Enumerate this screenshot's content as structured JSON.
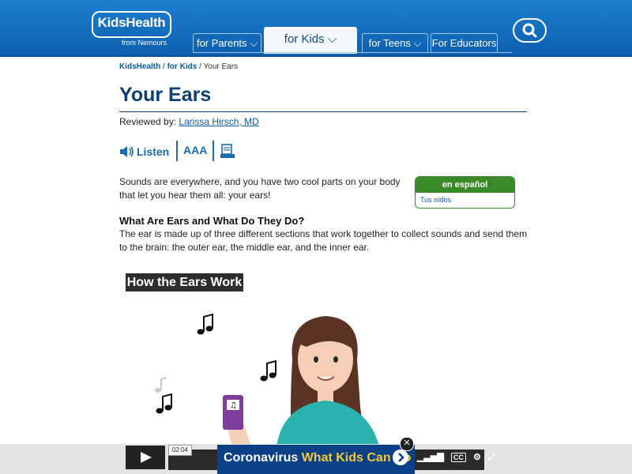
{
  "header": {
    "logo_text": "KidsHealth",
    "logo_sub": "from Nemours",
    "tabs": [
      {
        "label": "for Parents",
        "active": false
      },
      {
        "label": "for Kids",
        "active": true
      },
      {
        "label": "for Teens",
        "active": false
      },
      {
        "label": "For Educators",
        "active": false
      }
    ],
    "search_icon": "search-icon"
  },
  "breadcrumb": {
    "items": [
      "KidsHealth",
      "for Kids",
      "Your Ears"
    ]
  },
  "article": {
    "title": "Your Ears",
    "reviewed_label": "Reviewed by:",
    "reviewer": "Larissa Hirsch, MD",
    "tools": {
      "listen_label": "Listen",
      "text_size_label": "AAA",
      "print_icon": "print-icon"
    },
    "intro": "Sounds are everywhere, and you have two cool parts on your body that let you hear them all: your ears!",
    "espanol_box": {
      "header": "en español",
      "link": "Tus oídos"
    },
    "section_heading": "What Are Ears and What Do They Do?",
    "section_body": "The ear is made up of three different sections that work together to collect sounds and send them to the brain: the outer ear, the middle ear, and the inner ear.",
    "video_title": "How the Ears Work"
  },
  "video_bar": {
    "time": "02:04",
    "promo_text_a": "Coronavirus",
    "promo_text_b": "What Kids Can Do",
    "cc_label": "CC",
    "close_icon": "close-icon"
  },
  "colors": {
    "header_blue": "#0d5fae",
    "title_navy": "#0c3f74",
    "link_blue": "#0c5aa6",
    "espanol_green": "#3a8a2a",
    "promo_navy": "#0b3f86",
    "promo_yellow": "#f1c83d"
  }
}
